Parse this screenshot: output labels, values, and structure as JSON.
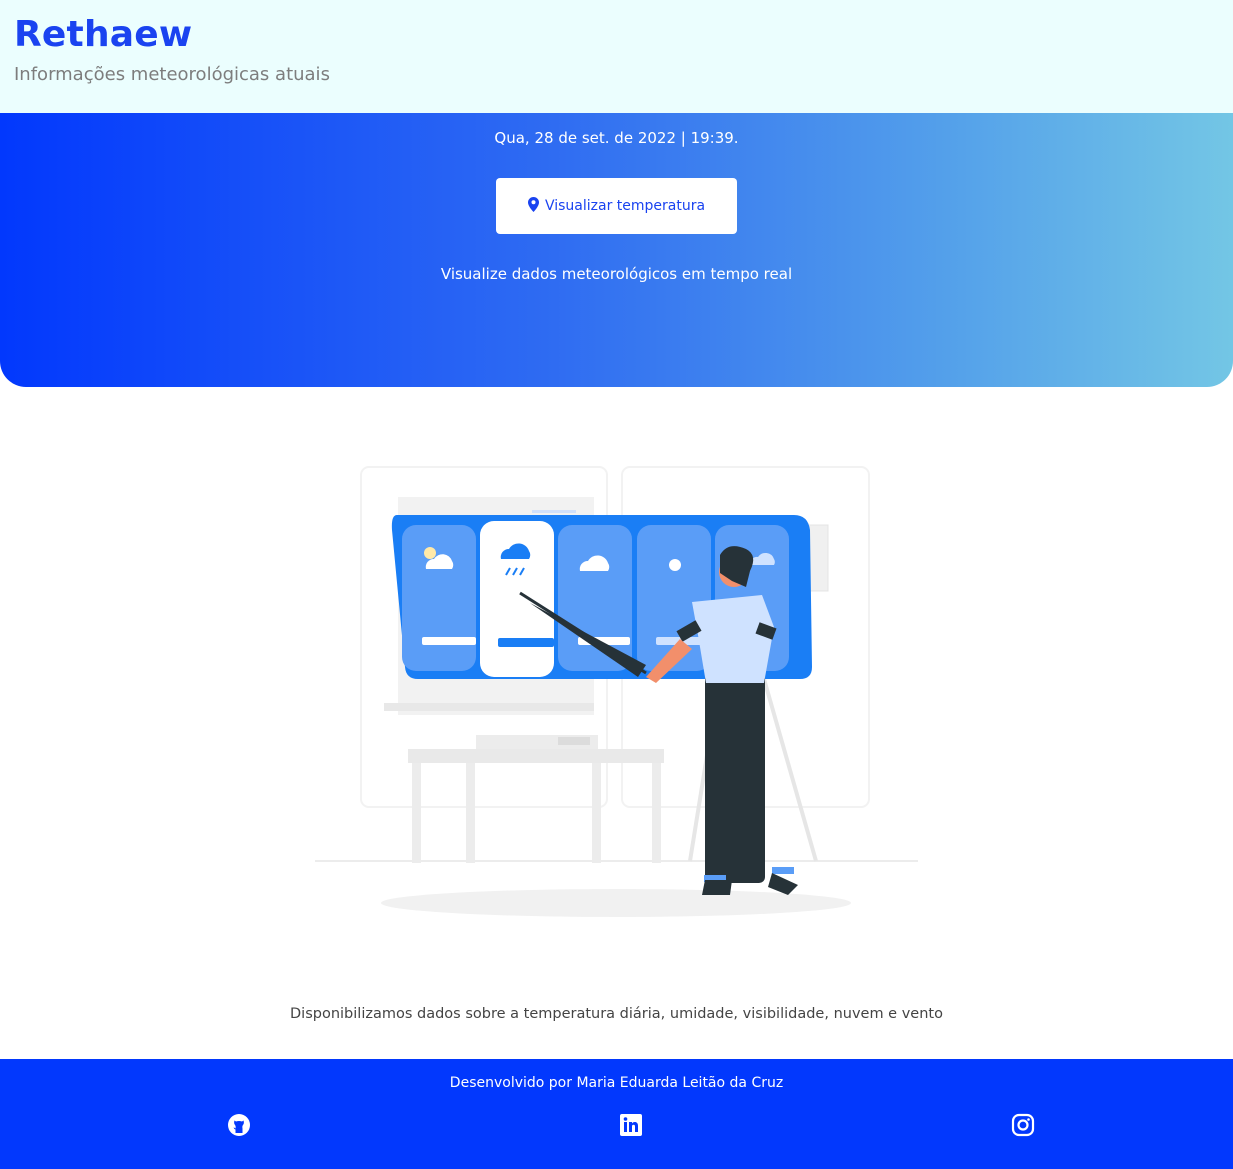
{
  "header": {
    "brand": "Rethaew",
    "tagline": "Informações meteorológicas atuais"
  },
  "hero": {
    "datetime": "Qua, 28 de set. de 2022 | 19:39.",
    "button_label": "Visualizar temperatura",
    "button_icon": "location-pin-icon",
    "subtitle": "Visualize dados meteorológicos em tempo real"
  },
  "main": {
    "description": "Disponibilizamos dados sobre a temperatura diária, umidade, visibilidade, nuvem e vento"
  },
  "footer": {
    "credit": "Desenvolvido por Maria Eduarda Leitão da Cruz",
    "social": [
      "github-icon",
      "linkedin-icon",
      "instagram-icon"
    ]
  },
  "colors": {
    "brand": "#1a43f0",
    "footer": "#0238fd",
    "hero_start": "#0238fd",
    "hero_end": "#73c6e5",
    "header_bg": "#ebfefe"
  }
}
